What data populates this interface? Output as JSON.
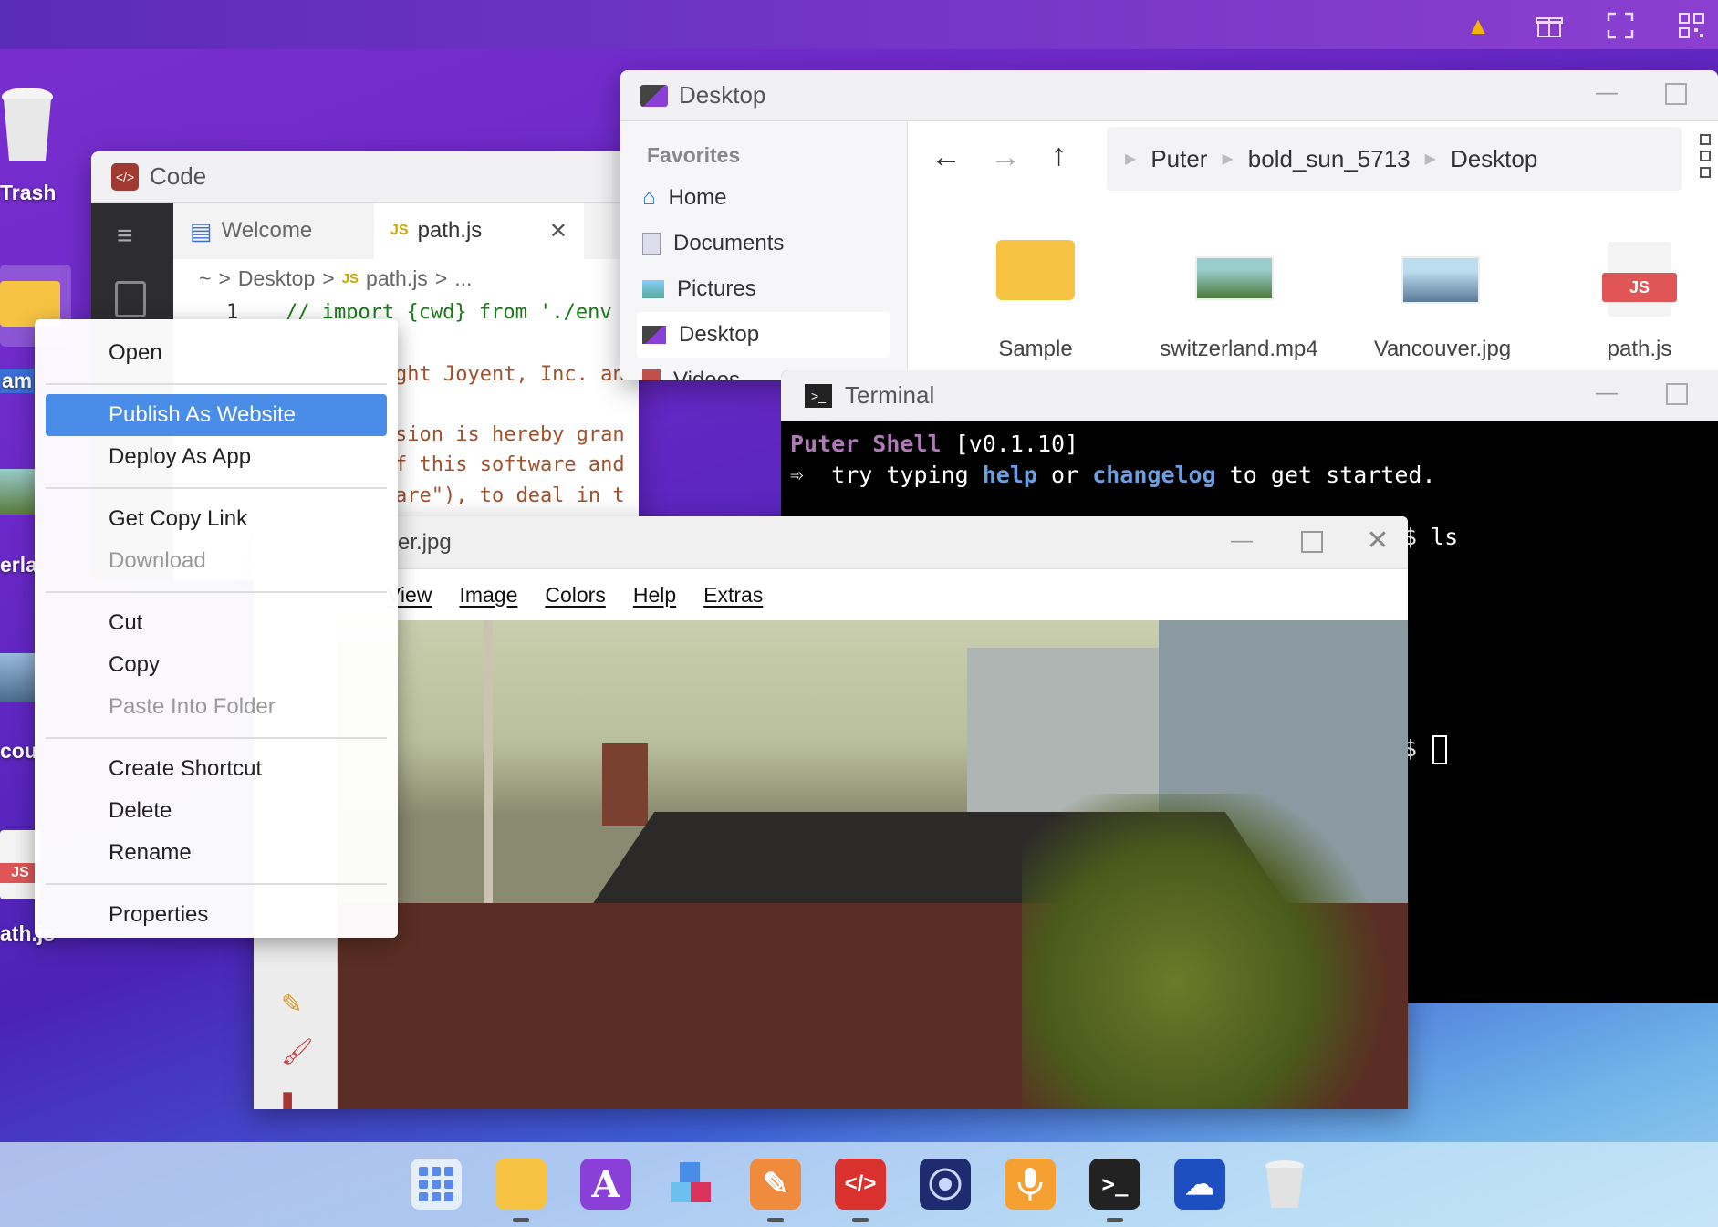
{
  "desktop": {
    "icons": [
      {
        "label": "Trash"
      },
      {
        "label": "am"
      },
      {
        "label": "erla"
      },
      {
        "label": "cou"
      },
      {
        "label": "ath.js"
      }
    ]
  },
  "code": {
    "title": "Code",
    "tabs": [
      {
        "label": "Welcome"
      },
      {
        "label": "path.js",
        "badge": "JS"
      }
    ],
    "breadcrumb": [
      "~",
      ">",
      "Desktop",
      ">",
      "JS",
      "path.js",
      ">",
      "..."
    ],
    "line_number": "1",
    "lines": [
      "// import {cwd} from './env",
      "ght Joyent, Inc. an",
      "sion is hereby gran",
      "f this software and",
      "are\"), to deal in t"
    ]
  },
  "explorer": {
    "title": "Desktop",
    "favorites_heading": "Favorites",
    "favorites": [
      {
        "label": "Home",
        "icon": "home-icon"
      },
      {
        "label": "Documents",
        "icon": "documents-icon"
      },
      {
        "label": "Pictures",
        "icon": "pictures-icon"
      },
      {
        "label": "Desktop",
        "icon": "desktop-icon"
      },
      {
        "label": "Videos",
        "icon": "videos-icon"
      }
    ],
    "path": [
      "Puter",
      "bold_sun_5713",
      "Desktop"
    ],
    "files": [
      {
        "label": "Sample",
        "type": "folder"
      },
      {
        "label": "switzerland.mp4",
        "type": "video"
      },
      {
        "label": "Vancouver.jpg",
        "type": "image"
      },
      {
        "label": "path.js",
        "type": "js"
      }
    ],
    "js_badge": "JS"
  },
  "terminal": {
    "title": "Terminal",
    "shell_name": "Puter Shell",
    "version": "[v0.1.10]",
    "line2_prefix": "try typing",
    "help": "help",
    "or": "or",
    "changelog": "changelog",
    "line2_suffix": "to get started.",
    "prompt_tail": "$ ls",
    "prompt_tail2": "$"
  },
  "paint": {
    "title": "er.jpg",
    "menus": [
      "View",
      "Image",
      "Colors",
      "Help",
      "Extras"
    ]
  },
  "context_menu": {
    "groups": [
      [
        {
          "label": "Open",
          "state": "normal"
        }
      ],
      [
        {
          "label": "Publish As Website",
          "state": "highlighted"
        },
        {
          "label": "Deploy As App",
          "state": "normal"
        }
      ],
      [
        {
          "label": "Get Copy Link",
          "state": "normal"
        },
        {
          "label": "Download",
          "state": "disabled"
        }
      ],
      [
        {
          "label": "Cut",
          "state": "normal"
        },
        {
          "label": "Copy",
          "state": "normal"
        },
        {
          "label": "Paste Into Folder",
          "state": "disabled"
        }
      ],
      [
        {
          "label": "Create Shortcut",
          "state": "normal"
        },
        {
          "label": "Delete",
          "state": "normal"
        },
        {
          "label": "Rename",
          "state": "normal"
        }
      ],
      [
        {
          "label": "Properties",
          "state": "normal"
        }
      ]
    ]
  },
  "taskbar": {
    "apps": [
      {
        "name": "app-launcher",
        "glyph": "▦",
        "color": "#7aa7f0"
      },
      {
        "name": "files",
        "glyph": "",
        "color": "#f6c343"
      },
      {
        "name": "editor",
        "glyph": "A",
        "color": "#8a3fd8"
      },
      {
        "name": "3d-blocks",
        "glyph": "◆",
        "color": "#e8f0ff"
      },
      {
        "name": "paint",
        "glyph": "✎",
        "color": "#f08a3c"
      },
      {
        "name": "code",
        "glyph": "</>",
        "color": "#d9322e"
      },
      {
        "name": "camera",
        "glyph": "◉",
        "color": "#1e2b6e"
      },
      {
        "name": "recorder",
        "glyph": "🎙",
        "color": "#f5a030"
      },
      {
        "name": "terminal",
        "glyph": ">_",
        "color": "#222"
      },
      {
        "name": "network",
        "glyph": "☁",
        "color": "#1e4fc0"
      },
      {
        "name": "trash",
        "glyph": "🗑",
        "color": "#e0e0e0"
      }
    ]
  },
  "colors": {
    "highlight": "#4a8de8",
    "shell_name": "#b07ab8",
    "keyword": "#6d9fe0"
  }
}
